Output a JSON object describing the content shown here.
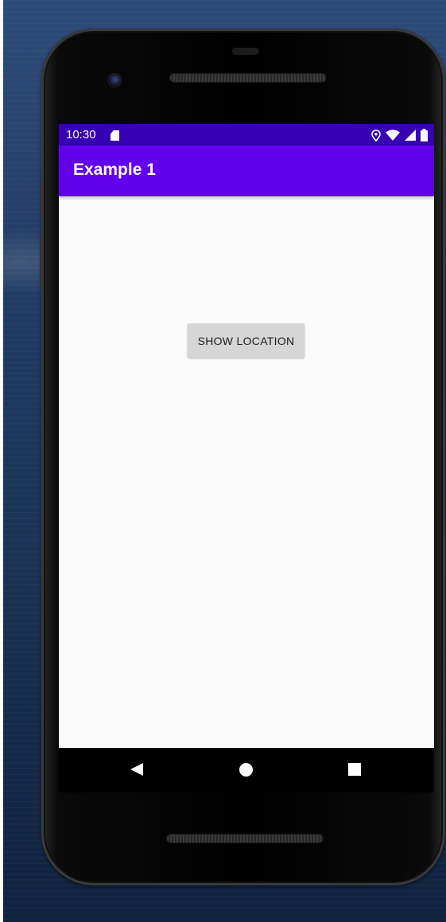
{
  "status_bar": {
    "time": "10:30",
    "icons": [
      "sd-card-icon",
      "location-icon",
      "wifi-icon",
      "signal-icon",
      "battery-icon"
    ]
  },
  "app_bar": {
    "title": "Example 1"
  },
  "main": {
    "show_location_label": "SHOW LOCATION"
  },
  "nav_bar": {
    "icons": [
      "back-icon",
      "home-icon",
      "recents-icon"
    ]
  },
  "colors": {
    "status_bar": "#3700b3",
    "app_bar": "#6200ee",
    "screen_background": "#fafafa",
    "button_background": "#d6d6d6"
  }
}
